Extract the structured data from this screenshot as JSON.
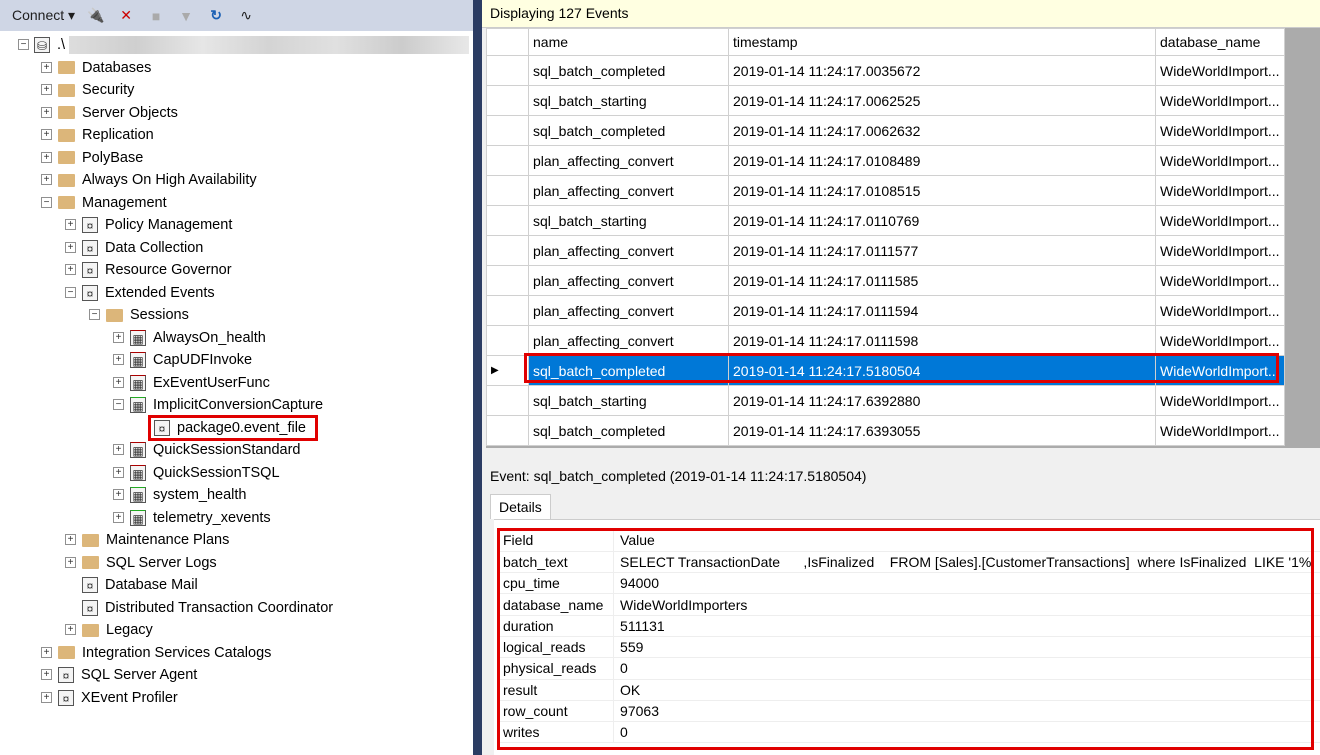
{
  "toolbar": {
    "connect": "Connect ▾",
    "icons": [
      "connect-icon",
      "disconnect-icon",
      "stop-icon",
      "filter-icon",
      "refresh-icon",
      "activity-monitor-icon"
    ]
  },
  "tree": [
    {
      "label": ".\\",
      "level": 0,
      "exp": "−",
      "icon": "server-icon"
    },
    {
      "label": "Databases",
      "level": 1,
      "exp": "+",
      "icon": "folder"
    },
    {
      "label": "Security",
      "level": 1,
      "exp": "+",
      "icon": "folder"
    },
    {
      "label": "Server Objects",
      "level": 1,
      "exp": "+",
      "icon": "folder"
    },
    {
      "label": "Replication",
      "level": 1,
      "exp": "+",
      "icon": "folder"
    },
    {
      "label": "PolyBase",
      "level": 1,
      "exp": "+",
      "icon": "folder"
    },
    {
      "label": "Always On High Availability",
      "level": 1,
      "exp": "+",
      "icon": "folder"
    },
    {
      "label": "Management",
      "level": 1,
      "exp": "−",
      "icon": "folder"
    },
    {
      "label": "Policy Management",
      "level": 2,
      "exp": "+",
      "icon": "policy-icon"
    },
    {
      "label": "Data Collection",
      "level": 2,
      "exp": "+",
      "icon": "data-collection-icon"
    },
    {
      "label": "Resource Governor",
      "level": 2,
      "exp": "+",
      "icon": "resource-governor-icon"
    },
    {
      "label": "Extended Events",
      "level": 2,
      "exp": "−",
      "icon": "extended-events-icon"
    },
    {
      "label": "Sessions",
      "level": 3,
      "exp": "−",
      "icon": "folder"
    },
    {
      "label": "AlwaysOn_health",
      "level": 4,
      "exp": "+",
      "icon": "session-stopped-icon"
    },
    {
      "label": "CapUDFInvoke",
      "level": 4,
      "exp": "+",
      "icon": "session-stopped-icon"
    },
    {
      "label": "ExEventUserFunc",
      "level": 4,
      "exp": "+",
      "icon": "session-stopped-icon"
    },
    {
      "label": "ImplicitConversionCapture",
      "level": 4,
      "exp": "−",
      "icon": "session-running-icon"
    },
    {
      "label": "package0.event_file",
      "level": 5,
      "exp": "",
      "icon": "event-file-icon"
    },
    {
      "label": "QuickSessionStandard",
      "level": 4,
      "exp": "+",
      "icon": "session-stopped-icon"
    },
    {
      "label": "QuickSessionTSQL",
      "level": 4,
      "exp": "+",
      "icon": "session-stopped-icon"
    },
    {
      "label": "system_health",
      "level": 4,
      "exp": "+",
      "icon": "session-running-icon"
    },
    {
      "label": "telemetry_xevents",
      "level": 4,
      "exp": "+",
      "icon": "session-running-icon"
    },
    {
      "label": "Maintenance Plans",
      "level": 2,
      "exp": "+",
      "icon": "folder"
    },
    {
      "label": "SQL Server Logs",
      "level": 2,
      "exp": "+",
      "icon": "folder"
    },
    {
      "label": "Database Mail",
      "level": 2,
      "exp": "",
      "icon": "database-mail-icon"
    },
    {
      "label": "Distributed Transaction Coordinator",
      "level": 2,
      "exp": "",
      "icon": "dtc-icon"
    },
    {
      "label": "Legacy",
      "level": 2,
      "exp": "+",
      "icon": "folder"
    },
    {
      "label": "Integration Services Catalogs",
      "level": 1,
      "exp": "+",
      "icon": "folder"
    },
    {
      "label": "SQL Server Agent",
      "level": 1,
      "exp": "+",
      "icon": "agent-icon"
    },
    {
      "label": "XEvent Profiler",
      "level": 1,
      "exp": "+",
      "icon": "xevent-profiler-icon"
    }
  ],
  "events": {
    "displaying": "Displaying 127 Events",
    "columns": [
      "name",
      "timestamp",
      "database_name"
    ],
    "rows": [
      [
        "sql_batch_completed",
        "2019-01-14 11:24:17.0035672",
        "WideWorldImport..."
      ],
      [
        "sql_batch_starting",
        "2019-01-14 11:24:17.0062525",
        "WideWorldImport..."
      ],
      [
        "sql_batch_completed",
        "2019-01-14 11:24:17.0062632",
        "WideWorldImport..."
      ],
      [
        "plan_affecting_convert",
        "2019-01-14 11:24:17.0108489",
        "WideWorldImport..."
      ],
      [
        "plan_affecting_convert",
        "2019-01-14 11:24:17.0108515",
        "WideWorldImport..."
      ],
      [
        "sql_batch_starting",
        "2019-01-14 11:24:17.0110769",
        "WideWorldImport..."
      ],
      [
        "plan_affecting_convert",
        "2019-01-14 11:24:17.0111577",
        "WideWorldImport..."
      ],
      [
        "plan_affecting_convert",
        "2019-01-14 11:24:17.0111585",
        "WideWorldImport..."
      ],
      [
        "plan_affecting_convert",
        "2019-01-14 11:24:17.0111594",
        "WideWorldImport..."
      ],
      [
        "plan_affecting_convert",
        "2019-01-14 11:24:17.0111598",
        "WideWorldImport..."
      ],
      [
        "sql_batch_completed",
        "2019-01-14 11:24:17.5180504",
        "WideWorldImport..."
      ],
      [
        "sql_batch_starting",
        "2019-01-14 11:24:17.6392880",
        "WideWorldImport..."
      ],
      [
        "sql_batch_completed",
        "2019-01-14 11:24:17.6393055",
        "WideWorldImport..."
      ]
    ],
    "selected_index": 10,
    "selection_color": "#0078d7"
  },
  "details": {
    "event_label": "Event: sql_batch_completed (2019-01-14 11:24:17.5180504)",
    "tab": "Details",
    "columns": [
      "Field",
      "Value"
    ],
    "rows": [
      [
        "batch_text",
        "SELECT TransactionDate      ,IsFinalized    FROM [Sales].[CustomerTransactions]  where IsFinalized  LIKE '1%'"
      ],
      [
        "cpu_time",
        "94000"
      ],
      [
        "database_name",
        "WideWorldImporters"
      ],
      [
        "duration",
        "511131"
      ],
      [
        "logical_reads",
        "559"
      ],
      [
        "physical_reads",
        "0"
      ],
      [
        "result",
        "OK"
      ],
      [
        "row_count",
        "97063"
      ],
      [
        "writes",
        "0"
      ]
    ]
  },
  "highlight_color": "#e00000"
}
